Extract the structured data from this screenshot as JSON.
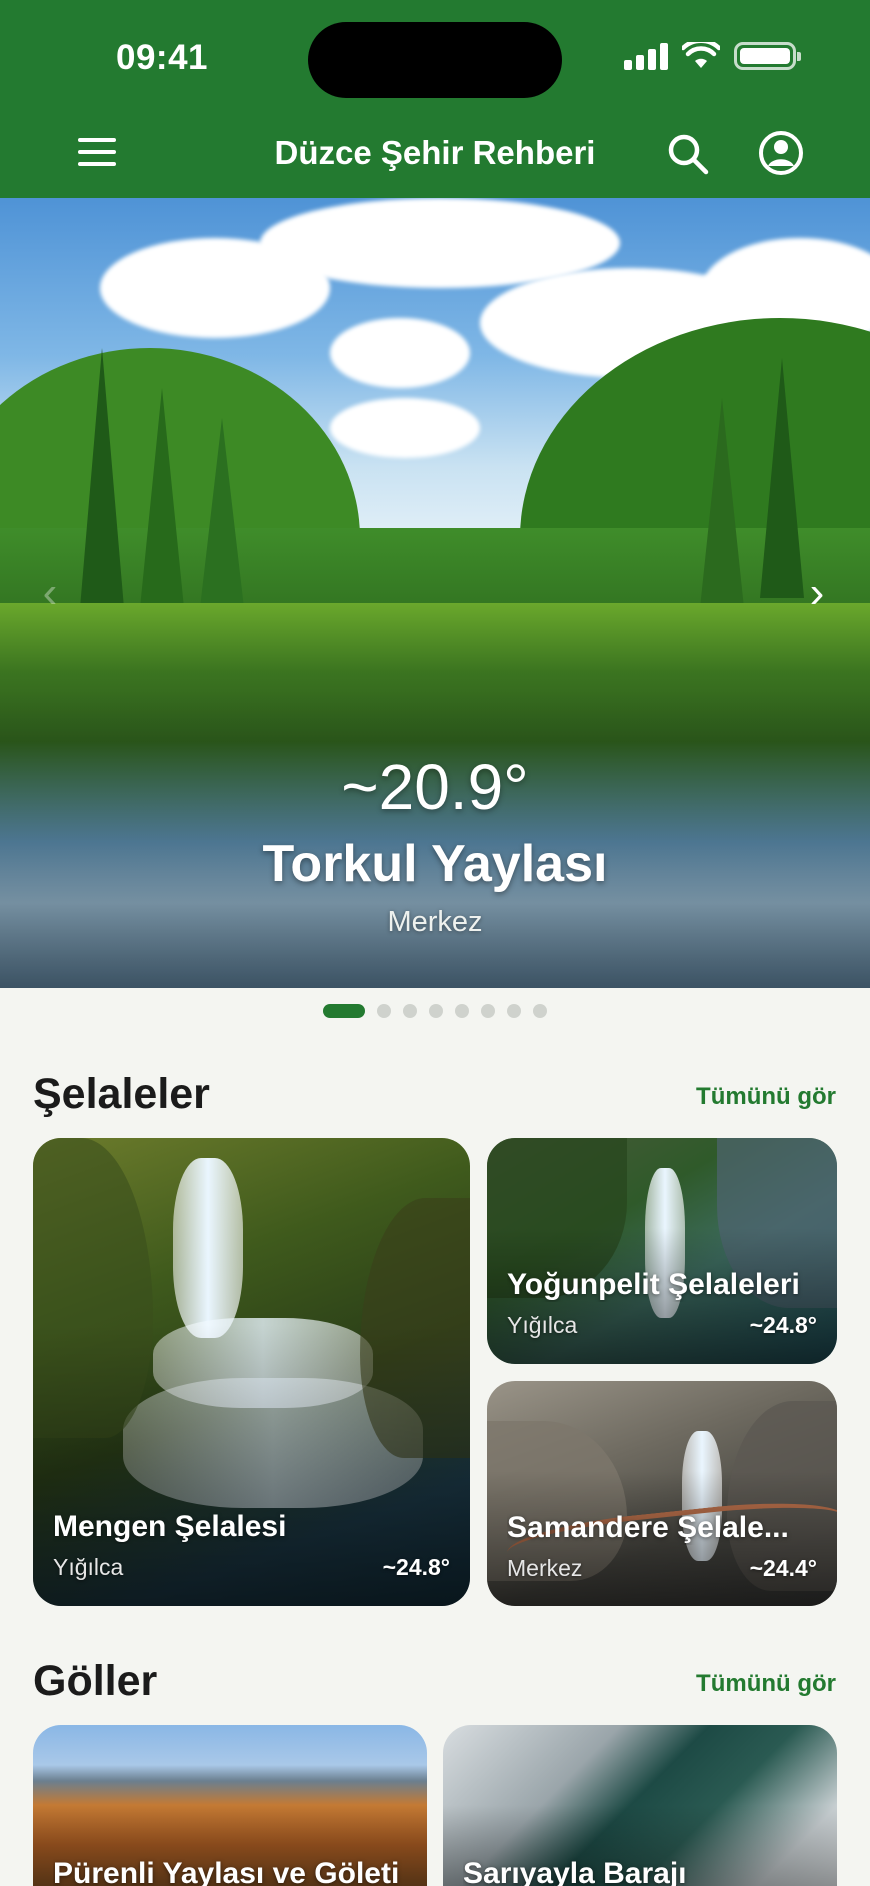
{
  "status_bar": {
    "time": "09:41"
  },
  "header": {
    "title": "Düzce Şehir Rehberi"
  },
  "hero": {
    "temperature": "~20.9°",
    "name": "Torkul Yaylası",
    "location": "Merkez",
    "slide_count": 8,
    "active_slide": 1
  },
  "sections": {
    "waterfalls": {
      "title": "Şelaleler",
      "see_all": "Tümünü gör",
      "cards": [
        {
          "title": "Mengen Şelalesi",
          "location": "Yığılca",
          "temperature": "~24.8°"
        },
        {
          "title": "Yoğunpelit Şelaleleri",
          "location": "Yığılca",
          "temperature": "~24.8°"
        },
        {
          "title": "Samandere Şelale...",
          "location": "Merkez",
          "temperature": "~24.4°"
        }
      ]
    },
    "lakes": {
      "title": "Göller",
      "see_all": "Tümünü gör",
      "cards": [
        {
          "title": "Pürenli Yaylası ve Göleti"
        },
        {
          "title": "Sarıyayla Barajı"
        }
      ]
    }
  },
  "colors": {
    "primary": "#237a30",
    "background": "#f4f5f1"
  },
  "icons": [
    "menu-icon",
    "search-icon",
    "profile-icon",
    "chevron-left-icon",
    "chevron-right-icon",
    "signal-icon",
    "wifi-icon",
    "battery-icon"
  ]
}
